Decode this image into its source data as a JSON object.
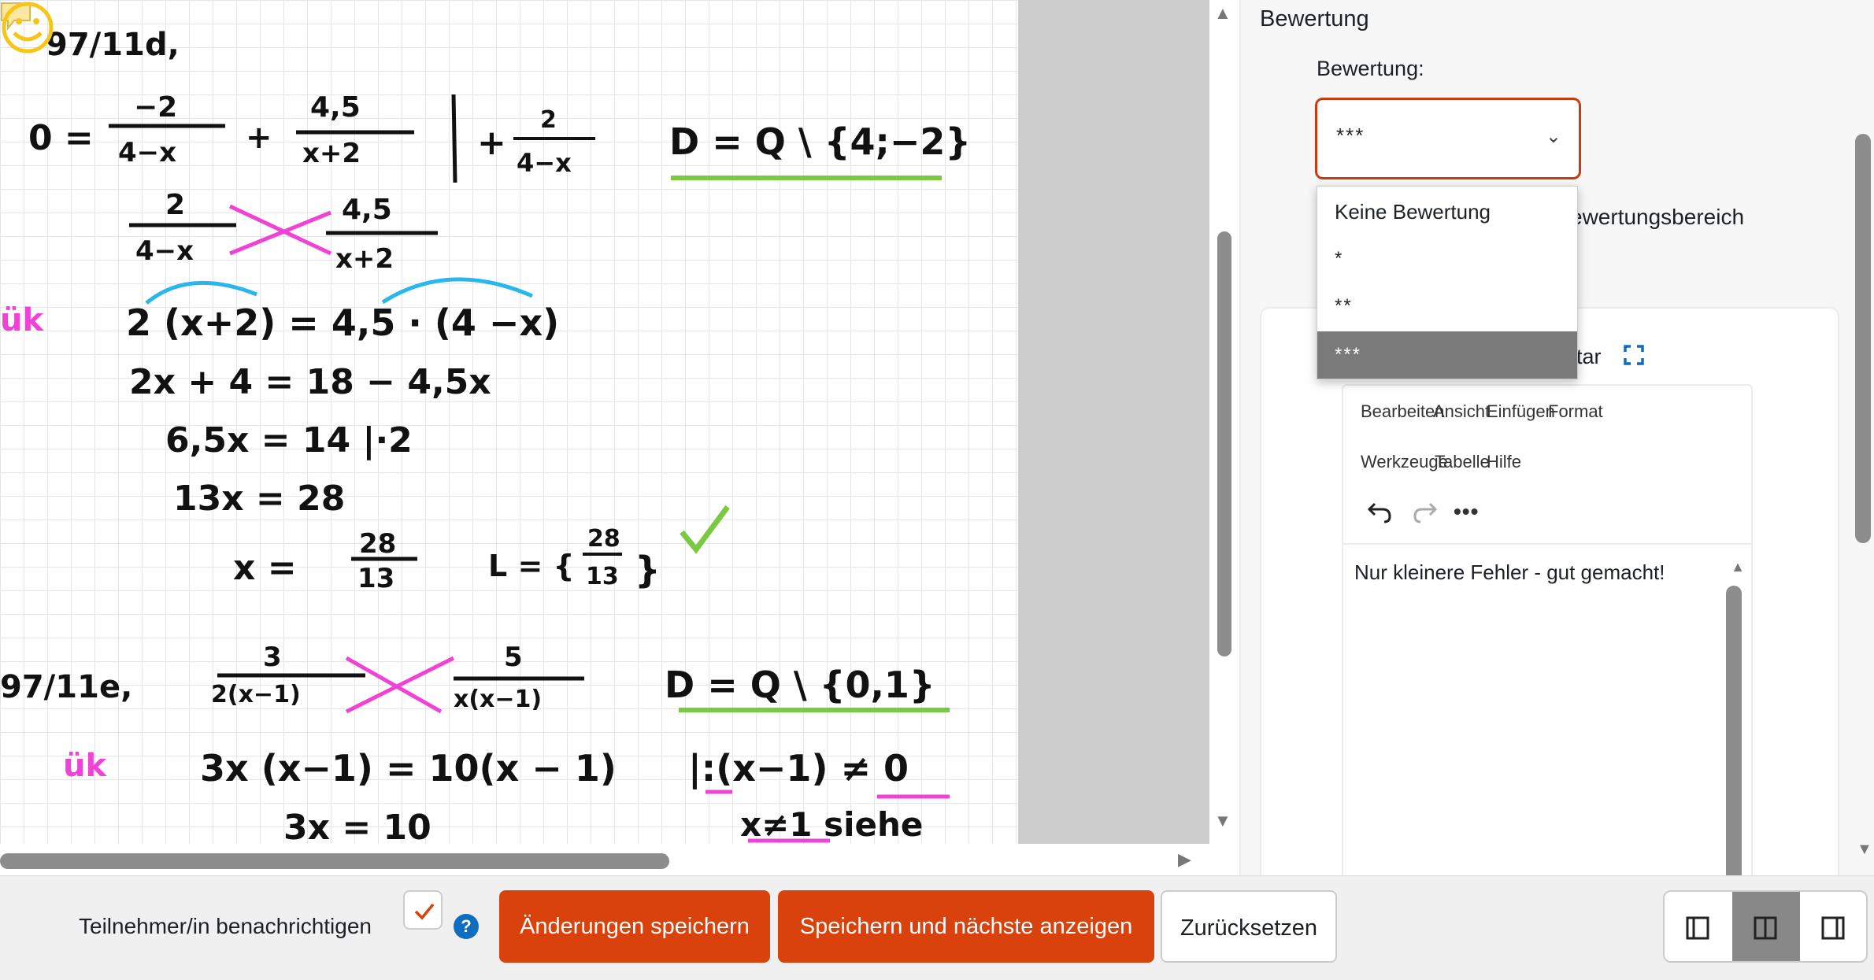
{
  "document": {
    "handwriting": {
      "ex1_title": "97/11d,",
      "ex1_eq1_lhs": "0 =",
      "ex1_f1_num": "−2",
      "ex1_f1_den": "4−x",
      "ex1_plus": "+",
      "ex1_f2_num": "4,5",
      "ex1_f2_den": "x+2",
      "ex1_op": "| +",
      "ex1_f3_num": "2",
      "ex1_f3_den": "4−x",
      "ex1_domain": "D = Q \\ {4;−2}",
      "ex1_l2_f1_num": "2",
      "ex1_l2_f1_den": "4−x",
      "ex1_l2_f2_num": "4,5",
      "ex1_l2_f2_den": "x+2",
      "uk1": "ük",
      "ex1_l3": "2 (x+2) = 4,5 · (4 −x)",
      "ex1_l4": "2x + 4  =  18 − 4,5x",
      "ex1_l5": "6,5x  =  14    |·2",
      "ex1_l6": "13x  =  28",
      "ex1_l7_lhs": "x =",
      "ex1_l7_num": "28",
      "ex1_l7_den": "13",
      "ex1_solution": "L = {",
      "ex1_sol_num": "28",
      "ex1_sol_den": "13",
      "ex1_sol_close": "}",
      "ex2_title": "97/11e,",
      "ex2_f1_num": "3",
      "ex2_f1_den": "2(x−1)",
      "ex2_f2_num": "5",
      "ex2_f2_den": "x(x−1)",
      "ex2_domain": "D = Q \\ {0,1}",
      "uk2": "ük",
      "ex2_l2": "3x (x−1) = 10(x − 1)",
      "ex2_l2_op": "|:(x−1) ≠ 0",
      "ex2_l3": "3x   = 10",
      "ex2_note": "x≠1  siehe"
    }
  },
  "grading": {
    "heading": "Bewertung",
    "grade_label": "Bewertung:",
    "selected_grade": "***",
    "options": [
      "Keine Bewertung",
      "*",
      "**",
      "***"
    ],
    "range_text": "ewertungsbereich",
    "feedback_label": "tar",
    "editor": {
      "menu": [
        "Bearbeiten",
        "Ansicht",
        "Einfügen",
        "Format",
        "Werkzeuge",
        "Tabelle",
        "Hilfe"
      ],
      "content": "Nur kleinere Fehler - gut gemacht!"
    }
  },
  "footer": {
    "notify_label": "Teilnehmer/in benachrichtigen",
    "help": "?",
    "save": "Änderungen speichern",
    "save_next": "Speichern und nächste anzeigen",
    "reset": "Zurücksetzen"
  },
  "colors": {
    "accent": "#d9410d",
    "select_border": "#c93c0f",
    "help_blue": "#0f6cbf",
    "handwriting_pink": "#f043d6",
    "handwriting_green": "#7ac943",
    "handwriting_cyan": "#29b6e8",
    "smiley_yellow": "#f5c518"
  },
  "icons": [
    "comment-icon",
    "smiley-icon",
    "checkmark-icon",
    "chevron-down-icon",
    "fullscreen-icon",
    "undo-icon",
    "redo-icon",
    "more-icon",
    "help-icon",
    "layout-left-icon",
    "layout-split-icon",
    "layout-right-icon"
  ]
}
